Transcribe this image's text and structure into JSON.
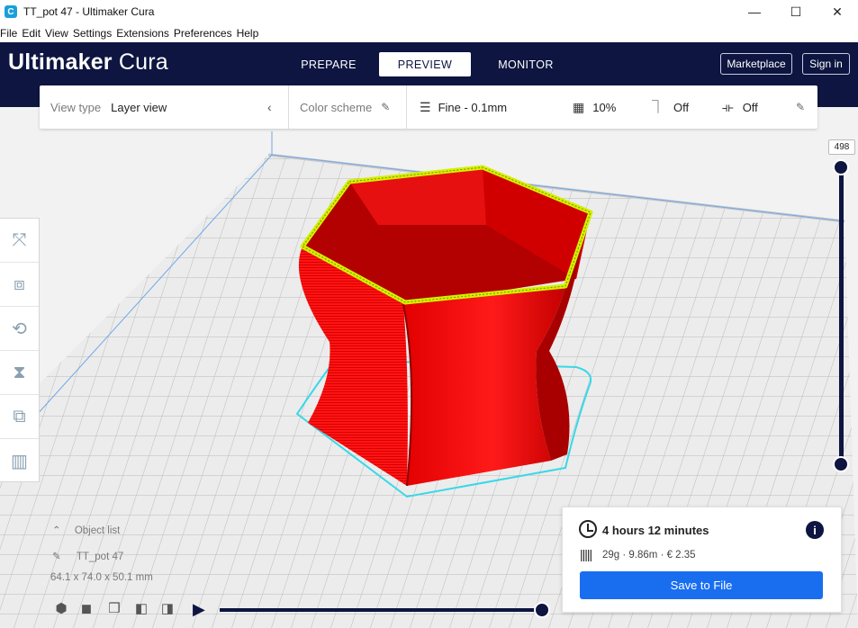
{
  "window": {
    "title": "TT_pot 47 - Ultimaker Cura",
    "app_icon_letter": "C",
    "minimize": "—",
    "maximize": "☐",
    "close": "✕"
  },
  "menu": [
    "File",
    "Edit",
    "View",
    "Settings",
    "Extensions",
    "Preferences",
    "Help"
  ],
  "header": {
    "logo_primary": "Ultimaker",
    "logo_secondary": "Cura",
    "tabs": [
      {
        "label": "PREPARE"
      },
      {
        "label": "PREVIEW"
      },
      {
        "label": "MONITOR"
      }
    ],
    "active_tab": "PREVIEW",
    "marketplace_label": "Marketplace",
    "signin_label": "Sign in"
  },
  "stage_toolbar": {
    "view_type_label": "View type",
    "view_type_value": "Layer view",
    "color_scheme_label": "Color scheme",
    "profile": "Fine - 0.1mm",
    "infill": "10%",
    "support": "Off",
    "adhesion": "Off"
  },
  "layer_slider": {
    "current_layer": "498",
    "upper_fraction": 1.0,
    "lower_fraction": 0.0
  },
  "object": {
    "list_label": "Object list",
    "name": "TT_pot 47",
    "dimensions": "64.1 x 74.0 x 50.1 mm"
  },
  "playback": {
    "progress": 1.0
  },
  "print_info": {
    "time": "4 hours 12 minutes",
    "material": "29g · 9.86m · € 2.35",
    "save_label": "Save to File",
    "info_glyph": "i"
  },
  "colors": {
    "header_bg": "#0d1540",
    "model_red": "#ff0000",
    "top_outline": "#d4f000",
    "skirt_cyan": "#38d8e8",
    "save_button": "#196ef0"
  },
  "icons": [
    "cura-app-icon",
    "pencil-icon",
    "chevron-left-icon",
    "profile-lines-icon",
    "infill-icon",
    "support-icon",
    "adhesion-icon",
    "clock-icon",
    "info-icon",
    "spool-icon",
    "play-icon"
  ]
}
